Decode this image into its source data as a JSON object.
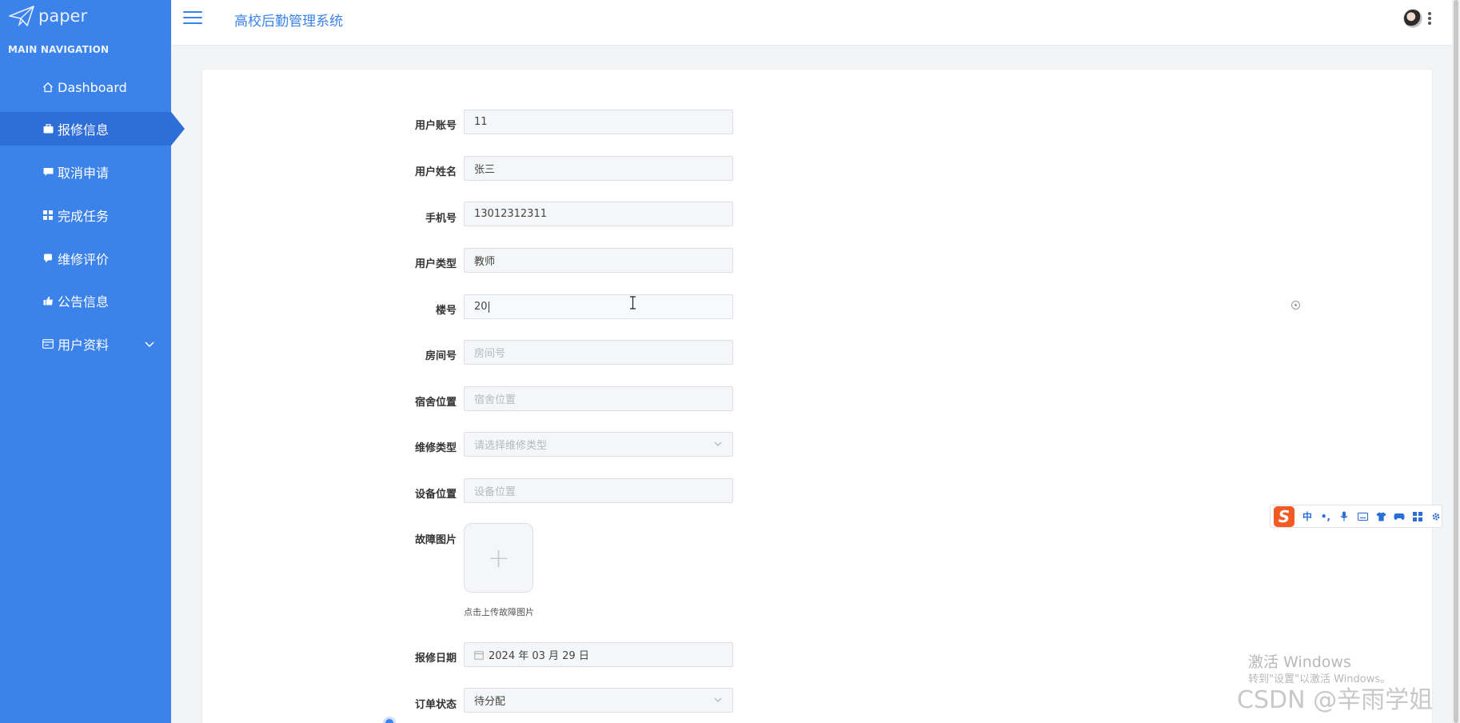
{
  "app": {
    "logo_text": "paper",
    "system_title": "高校后勤管理系统"
  },
  "sidebar": {
    "section_title": "MAIN NAVIGATION",
    "items": [
      {
        "label": "Dashboard",
        "icon": "home-icon"
      },
      {
        "label": "报修信息",
        "icon": "briefcase-icon"
      },
      {
        "label": "取消申请",
        "icon": "comment-icon"
      },
      {
        "label": "完成任务",
        "icon": "grid-icon"
      },
      {
        "label": "维修评价",
        "icon": "chat-icon"
      },
      {
        "label": "公告信息",
        "icon": "thumbs-up-icon"
      },
      {
        "label": "用户资料",
        "icon": "profile-icon"
      }
    ]
  },
  "form": {
    "fields": [
      {
        "label": "用户账号",
        "value": "11",
        "placeholder": ""
      },
      {
        "label": "用户姓名",
        "value": "张三",
        "placeholder": ""
      },
      {
        "label": "手机号",
        "value": "13012312311",
        "placeholder": ""
      },
      {
        "label": "用户类型",
        "value": "教师",
        "placeholder": ""
      },
      {
        "label": "楼号",
        "value": "20",
        "placeholder": ""
      },
      {
        "label": "房间号",
        "value": "",
        "placeholder": "房间号"
      },
      {
        "label": "宿舍位置",
        "value": "",
        "placeholder": "宿舍位置"
      },
      {
        "label": "维修类型",
        "value": "",
        "placeholder": "请选择维修类型"
      },
      {
        "label": "设备位置",
        "value": "",
        "placeholder": "设备位置"
      }
    ],
    "upload": {
      "label": "故障图片",
      "plus": "+",
      "hint": "点击上传故障图片"
    },
    "date": {
      "label": "报修日期",
      "value": "2024 年 03 月 29 日"
    },
    "status": {
      "label": "订单状态",
      "value": "待分配"
    }
  },
  "ime": {
    "mode": "中",
    "punct": "•,"
  },
  "overlay": {
    "windows_activate": "激活 Windows",
    "windows_activate_sub": "转到\"设置\"以激活 Windows。",
    "watermark": "CSDN @辛雨学姐"
  },
  "colors": {
    "sidebar": "#3b82ea",
    "sidebar_active": "#2e6ed9",
    "accent": "#3b82ea"
  }
}
